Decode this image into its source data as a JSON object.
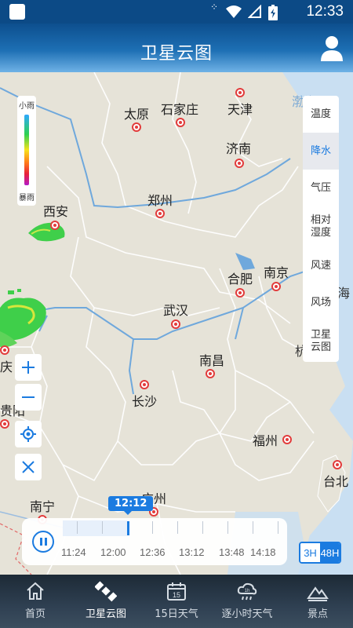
{
  "status": {
    "time": "12:33"
  },
  "header": {
    "title": "卫星云图"
  },
  "legend": {
    "top_label": "小雨",
    "bottom_label": "暴雨"
  },
  "cities": [
    {
      "name": "太原"
    },
    {
      "name": "石家庄"
    },
    {
      "name": "天津"
    },
    {
      "name": "济南"
    },
    {
      "name": "郑州"
    },
    {
      "name": "西安"
    },
    {
      "name": "合肥"
    },
    {
      "name": "南京"
    },
    {
      "name": "武汉"
    },
    {
      "name": "南昌"
    },
    {
      "name": "长沙"
    },
    {
      "name": "福州"
    },
    {
      "name": "广州"
    },
    {
      "name": "台北"
    },
    {
      "name": "南宁"
    },
    {
      "name": "渤海"
    },
    {
      "name": "海"
    },
    {
      "name": "杭"
    },
    {
      "name": "庆"
    },
    {
      "name": "贵阳"
    }
  ],
  "layers": {
    "items": [
      "温度",
      "降水",
      "气压",
      "相对湿度",
      "风速",
      "风场",
      "卫星云图"
    ],
    "active": "降水"
  },
  "timeline": {
    "current": "12:12",
    "labels": [
      "11:24",
      "12:00",
      "12:36",
      "13:12",
      "13:48",
      "14:18"
    ]
  },
  "range": {
    "short": "3H",
    "long": "48H",
    "selected": "48H"
  },
  "nav": {
    "items": [
      "首页",
      "卫星云图",
      "15日天气",
      "逐小时天气",
      "景点"
    ],
    "active": "卫星云图",
    "calendar_day": "15",
    "hourly_badge": "1h"
  }
}
